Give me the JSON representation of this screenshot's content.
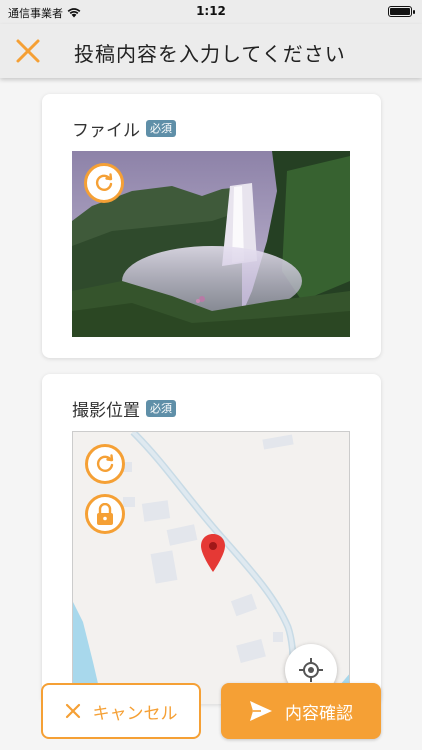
{
  "status_bar": {
    "carrier": "通信事業者",
    "time": "1:12"
  },
  "header": {
    "title": "投稿内容を入力してください"
  },
  "file_section": {
    "label": "ファイル",
    "badge": "必須"
  },
  "location_section": {
    "label": "撮影位置",
    "badge": "必須"
  },
  "actions": {
    "cancel_label": "キャンセル",
    "confirm_label": "内容確認"
  },
  "colors": {
    "accent": "#f5a035",
    "badge": "#5f8fa8",
    "map_pin": "#e53935"
  }
}
